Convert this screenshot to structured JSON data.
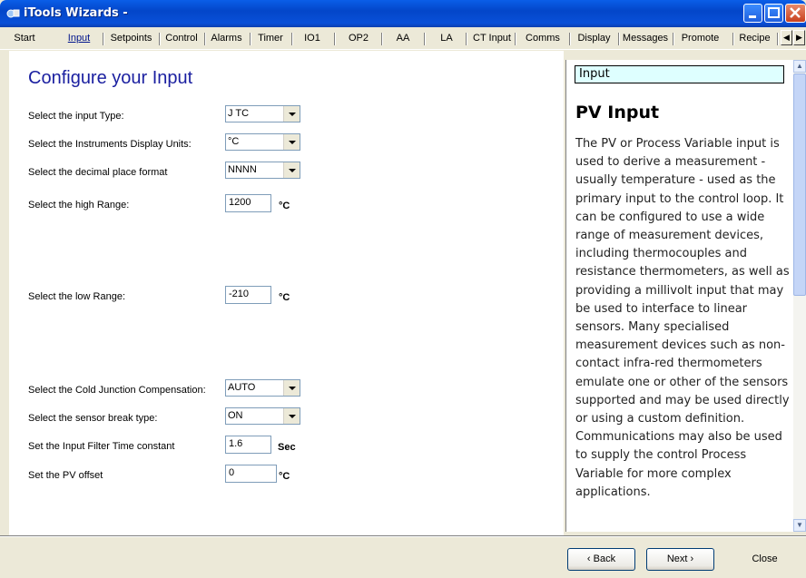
{
  "window": {
    "title": "iTools Wizards -",
    "app_icon": "itools-icon"
  },
  "tabs": [
    {
      "label": "Start",
      "active": false
    },
    {
      "label": "Input",
      "active": true
    },
    {
      "label": "Setpoints",
      "active": false
    },
    {
      "label": "Control",
      "active": false
    },
    {
      "label": "Alarms",
      "active": false
    },
    {
      "label": "Timer",
      "active": false
    },
    {
      "label": "IO1",
      "active": false
    },
    {
      "label": "OP2",
      "active": false
    },
    {
      "label": "AA",
      "active": false
    },
    {
      "label": "LA",
      "active": false
    },
    {
      "label": "CT Input",
      "active": false
    },
    {
      "label": "Comms",
      "active": false
    },
    {
      "label": "Display",
      "active": false
    },
    {
      "label": "Messages",
      "active": false
    },
    {
      "label": "Promote",
      "active": false
    },
    {
      "label": "Recipe",
      "active": false
    }
  ],
  "main": {
    "heading": "Configure your Input",
    "rows": [
      {
        "label": "Select the input Type:",
        "kind": "combo",
        "value": "J TC"
      },
      {
        "label": "Select the Instruments Display Units:",
        "kind": "combo",
        "value": "°C"
      },
      {
        "label": "Select the decimal place format",
        "kind": "combo",
        "value": "NNNN"
      },
      {
        "label": "Select the high Range:",
        "kind": "field",
        "value": "1200",
        "unit": "°C"
      },
      {
        "label": "Select the low Range:",
        "kind": "field",
        "value": "-210",
        "unit": "°C"
      },
      {
        "label": "Select the Cold Junction Compensation:",
        "kind": "combo",
        "value": "AUTO"
      },
      {
        "label": "Select the sensor break type:",
        "kind": "combo",
        "value": "ON"
      },
      {
        "label": "Set the Input Filter Time constant",
        "kind": "field",
        "value": "1.6",
        "unit": "Sec"
      },
      {
        "label": "Set the PV offset",
        "kind": "field",
        "value": "0",
        "unit": "°C"
      }
    ]
  },
  "help": {
    "header": "Input",
    "title": "PV Input",
    "body": "The PV or Process Variable input is used to derive a measurement - usually temperature - used as the primary input to the control loop. It can be configured to use a wide range of measurement devices, including thermocouples and resistance thermometers, as well as providing a millivolt input that may be used to interface to linear sensors. Many specialised measurement devices such as non-contact infra-red thermometers emulate one or other of the sensors supported and may be used directly or using a custom definition. Communications may also be used to supply the control Process Variable for more complex applications."
  },
  "footer": {
    "back": "‹ Back",
    "next": "Next ›",
    "close": "Close"
  }
}
